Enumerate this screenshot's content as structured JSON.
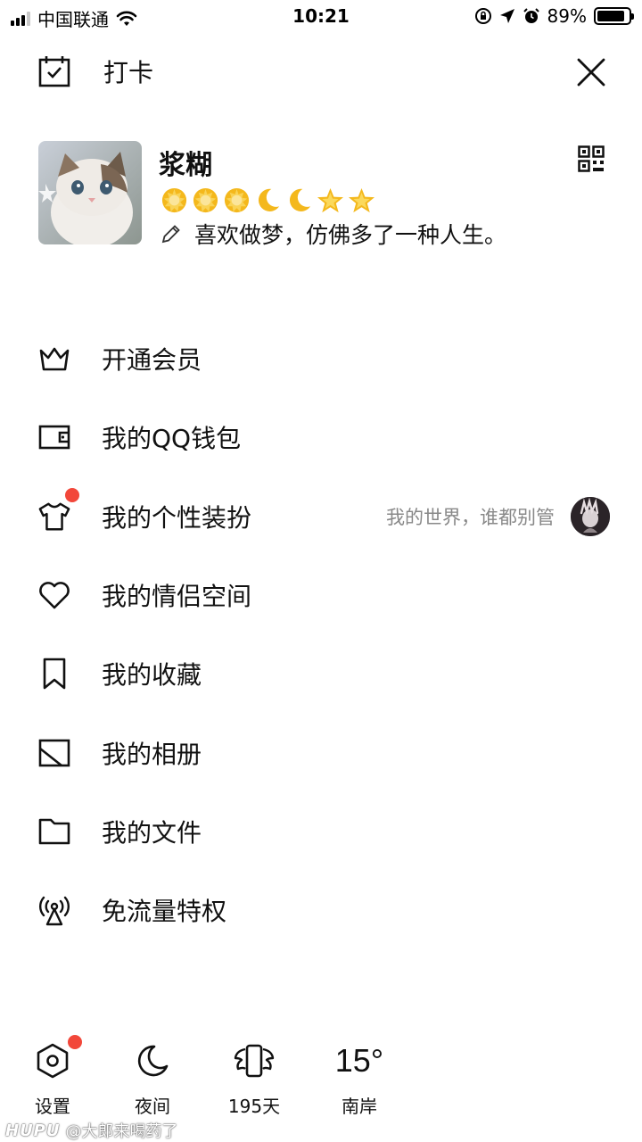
{
  "status_bar": {
    "carrier": "中国联通",
    "time": "10:21",
    "battery_percent": "89%",
    "battery_level": 0.89
  },
  "header": {
    "checkin_label": "打卡"
  },
  "profile": {
    "nickname": "浆糊",
    "level_icons": [
      "sun",
      "sun",
      "sun",
      "moon",
      "moon",
      "star",
      "star"
    ],
    "signature": "喜欢做梦，仿佛多了一种人生。"
  },
  "menu": {
    "items": [
      {
        "label": "开通会员",
        "icon": "crown-icon"
      },
      {
        "label": "我的QQ钱包",
        "icon": "wallet-icon"
      },
      {
        "label": "我的个性装扮",
        "icon": "tshirt-icon",
        "status": "我的世界，谁都别管",
        "badge": true
      },
      {
        "label": "我的情侣空间",
        "icon": "heart-icon"
      },
      {
        "label": "我的收藏",
        "icon": "bookmark-icon"
      },
      {
        "label": "我的相册",
        "icon": "photo-album-icon"
      },
      {
        "label": "我的文件",
        "icon": "folder-icon"
      },
      {
        "label": "免流量特权",
        "icon": "antenna-icon"
      }
    ]
  },
  "bottom_bar": {
    "settings_label": "设置",
    "night_label": "夜间",
    "days_label": "195天",
    "temperature": "15°",
    "location": "南岸"
  },
  "watermark": {
    "brand": "HUPU",
    "user": "@大郎来喝药了"
  },
  "colors": {
    "badge": "#f2473a",
    "text": "#111111",
    "secondary_text": "#888888"
  }
}
